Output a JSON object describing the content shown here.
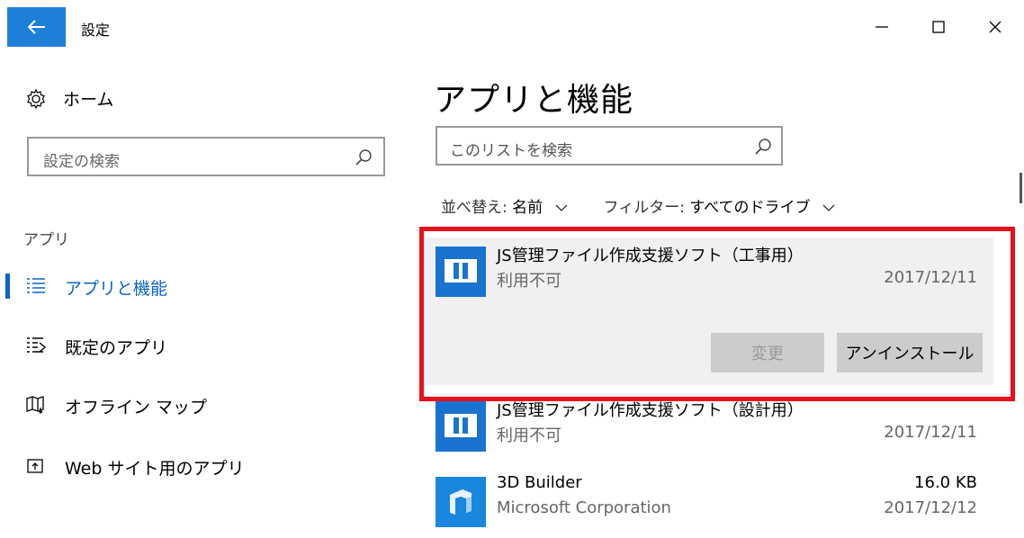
{
  "window": {
    "title": "設定"
  },
  "sidebar": {
    "home_label": "ホーム",
    "search_placeholder": "設定の検索",
    "section_label": "アプリ",
    "items": [
      {
        "label": "アプリと機能",
        "icon": "apps-features-icon",
        "active": true
      },
      {
        "label": "既定のアプリ",
        "icon": "default-apps-icon",
        "active": false
      },
      {
        "label": "オフライン マップ",
        "icon": "offline-maps-icon",
        "active": false
      },
      {
        "label": "Web サイト用のアプリ",
        "icon": "apps-for-websites-icon",
        "active": false
      }
    ]
  },
  "main": {
    "title": "アプリと機能",
    "search_placeholder": "このリストを検索",
    "sort_label": "並べ替え:",
    "sort_value": "名前",
    "filter_label": "フィルター:",
    "filter_value": "すべてのドライブ",
    "apps": [
      {
        "name": "JS管理ファイル作成支援ソフト（工事用）",
        "publisher": "利用不可",
        "size": "",
        "date": "2017/12/11",
        "selected": true,
        "change_label": "変更",
        "uninstall_label": "アンインストール"
      },
      {
        "name": "JS管理ファイル作成支援ソフト（設計用）",
        "publisher": "利用不可",
        "size": "",
        "date": "2017/12/11",
        "selected": false
      },
      {
        "name": "3D Builder",
        "publisher": "Microsoft Corporation",
        "size": "16.0 KB",
        "date": "2017/12/12",
        "selected": false
      }
    ]
  },
  "colors": {
    "accent": "#0a64c8",
    "back_button": "#1e7fd8",
    "highlight_border": "#e8101a",
    "selected_bg": "#f0f0f0"
  }
}
